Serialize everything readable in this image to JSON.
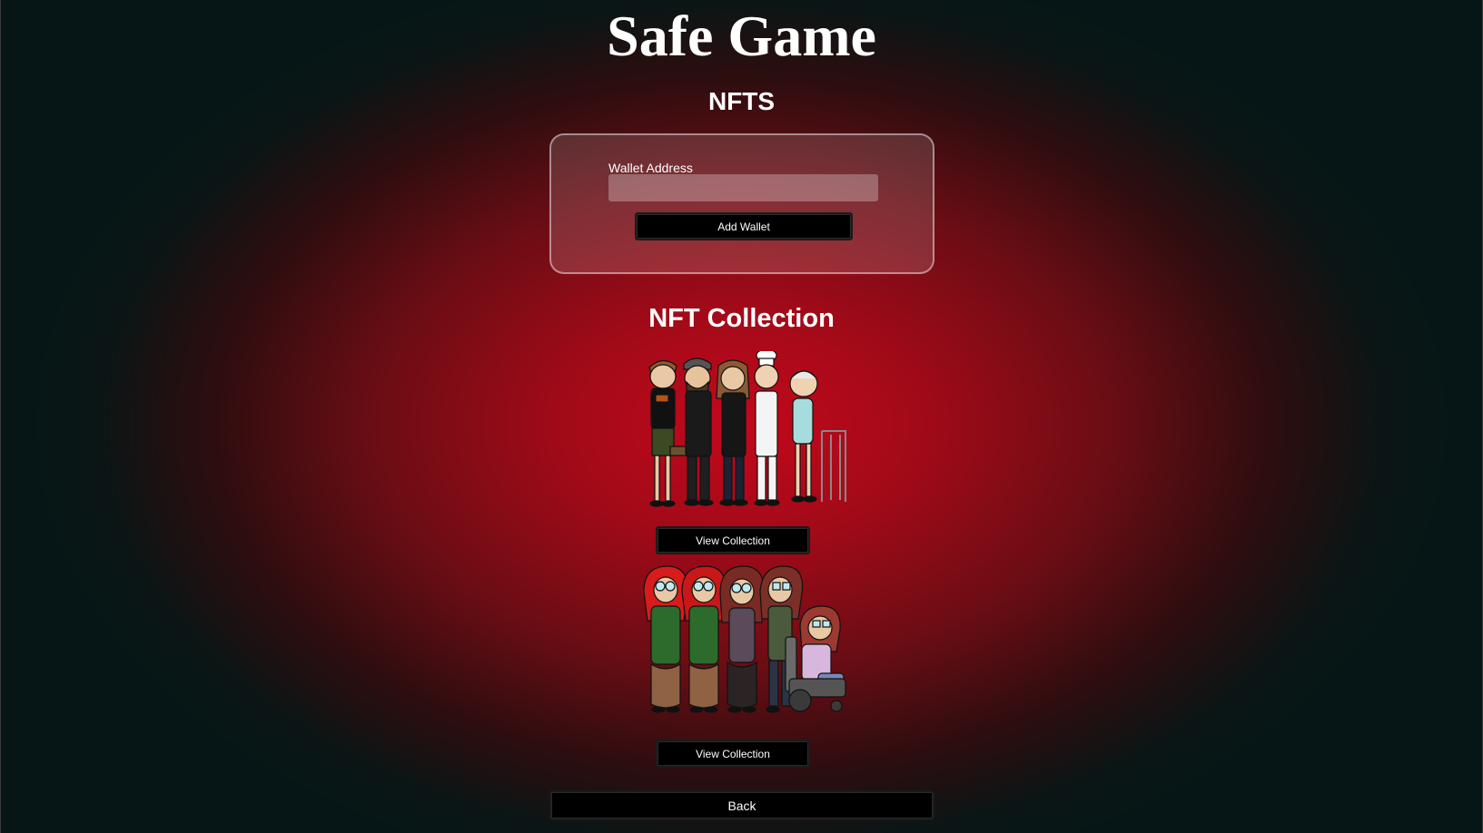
{
  "app": {
    "title": "Safe Game",
    "page_heading": "NFTS"
  },
  "wallet": {
    "label": "Wallet Address",
    "input_value": "",
    "input_placeholder": "",
    "add_button_label": "Add Wallet"
  },
  "collection": {
    "heading": "NFT Collection",
    "items": [
      {
        "view_label": "View Collection"
      },
      {
        "view_label": "View Collection"
      }
    ]
  },
  "nav": {
    "back_label": "Back"
  },
  "colors": {
    "background_center": "#c4081c",
    "background_edge": "#061616",
    "button_bg": "#000000",
    "text": "#ffffff"
  }
}
